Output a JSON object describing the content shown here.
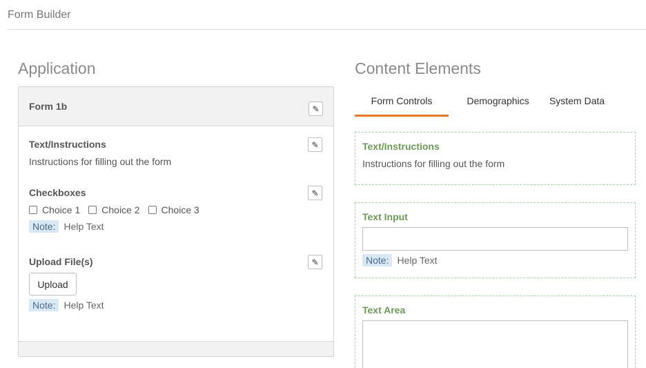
{
  "header": {
    "title": "Form Builder"
  },
  "application": {
    "title": "Application",
    "form_name": "Form 1b",
    "fields": {
      "text_instructions": {
        "label": "Text/Instructions",
        "text": "Instructions for filling out the form"
      },
      "checkboxes": {
        "label": "Checkboxes",
        "choices": [
          "Choice 1",
          "Choice 2",
          "Choice 3"
        ],
        "note_tag": "Note:",
        "note_text": "Help Text"
      },
      "upload": {
        "label": "Upload File(s)",
        "button": "Upload",
        "note_tag": "Note:",
        "note_text": "Help Text"
      }
    }
  },
  "content_elements": {
    "title": "Content Elements",
    "tabs": [
      {
        "label": "Form Controls",
        "active": true
      },
      {
        "label": "Demographics",
        "active": false
      },
      {
        "label": "System Data",
        "active": false
      }
    ],
    "items": {
      "text_instructions": {
        "label": "Text/Instructions",
        "text": "Instructions for filling out the form"
      },
      "text_input": {
        "label": "Text Input",
        "value": "",
        "note_tag": "Note:",
        "note_text": "Help Text"
      },
      "text_area": {
        "label": "Text Area",
        "value": ""
      }
    }
  },
  "icons": {
    "edit": "pencil-icon"
  },
  "colors": {
    "accent": "#e87722",
    "element_label": "#6b9a55",
    "note_bg": "#d9e8f5",
    "dashed_border": "#a8d0a8"
  }
}
